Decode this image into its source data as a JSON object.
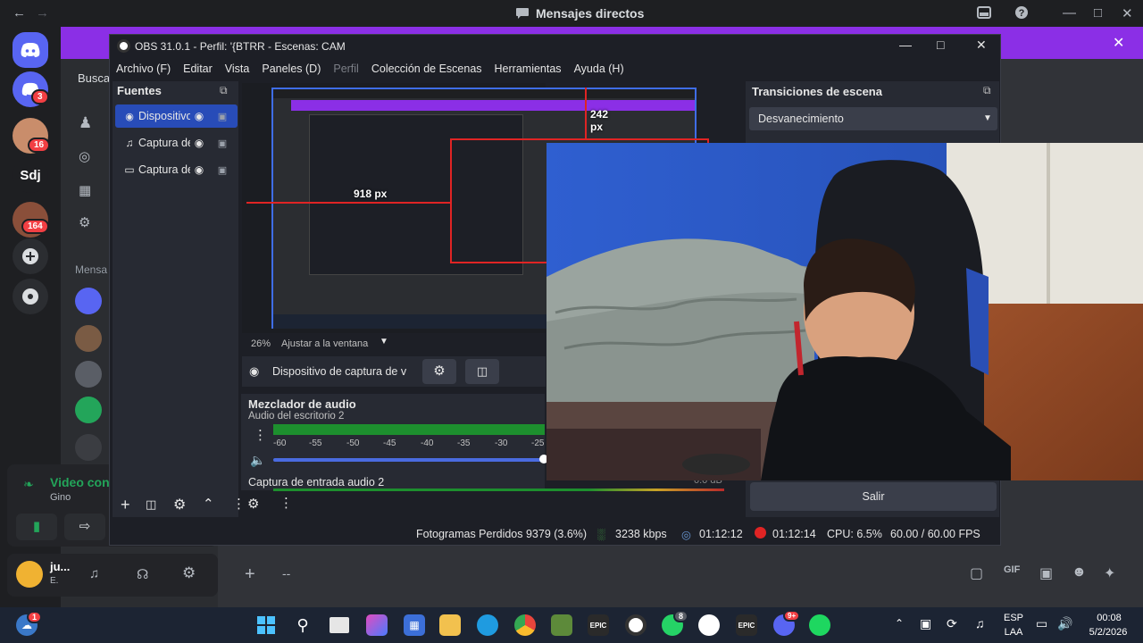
{
  "discord": {
    "window_title": "Mensajes directos",
    "search_placeholder": "Buscar",
    "dm_header": "Mensa",
    "server_sdj": "Sdj",
    "badges": [
      "3",
      "16",
      "164"
    ],
    "voice": {
      "title": "Video con",
      "subtitle": "Gino"
    },
    "user": {
      "name": "ju...",
      "status": "E."
    },
    "chat_input_placeholder": "--",
    "colors": {
      "banner": "#8b2fe6",
      "blurple": "#5865f2",
      "green": "#23a55a",
      "red": "#f23f43"
    }
  },
  "obs": {
    "title": "OBS 31.0.1 - Perfil: '{BTRR - Escenas: CAM",
    "menu": [
      "Archivo (F)",
      "Editar",
      "Vista",
      "Paneles (D)",
      "Perfil",
      "Colección de Escenas",
      "Herramientas",
      "Ayuda (H)"
    ],
    "sources_title": "Fuentes",
    "sources": [
      {
        "label": "Dispositivo",
        "icon": "camera-icon"
      },
      {
        "label": "Captura de",
        "icon": "microphone-icon"
      },
      {
        "label": "Captura de",
        "icon": "monitor-icon"
      }
    ],
    "zoom": "26%",
    "fit_label": "Ajustar a la ventana",
    "selected_source": "Dispositivo de captura de v",
    "mixer": {
      "title": "Mezclador de audio",
      "track1": "Audio del escritorio 2",
      "ticks": [
        "-60",
        "-55",
        "-50",
        "-45",
        "-40",
        "-35",
        "-30",
        "-25"
      ],
      "track2": "Captura de entrada audio 2",
      "db_value": "0.0 dB"
    },
    "transitions": {
      "title": "Transiciones de escena",
      "selected": "Desvanecimiento"
    },
    "exit_button": "Salir",
    "preview_measure": {
      "top": "242 px",
      "left": "918 px"
    },
    "status": {
      "dropped": "Fotogramas Perdidos 9379 (3.6%)",
      "bitrate": "3238 kbps",
      "stream_time": "01:12:12",
      "rec_time": "01:12:14",
      "cpu": "CPU: 6.5%",
      "fps": "60.00 / 60.00 FPS"
    }
  },
  "taskbar": {
    "lang": "ESP",
    "lang2": "LAA",
    "time": "00:08",
    "date": "5/2/2026",
    "weather_badge": "1",
    "whatsapp_badge": "8",
    "discord_badge": "9+",
    "epic_label": "EPIC"
  }
}
